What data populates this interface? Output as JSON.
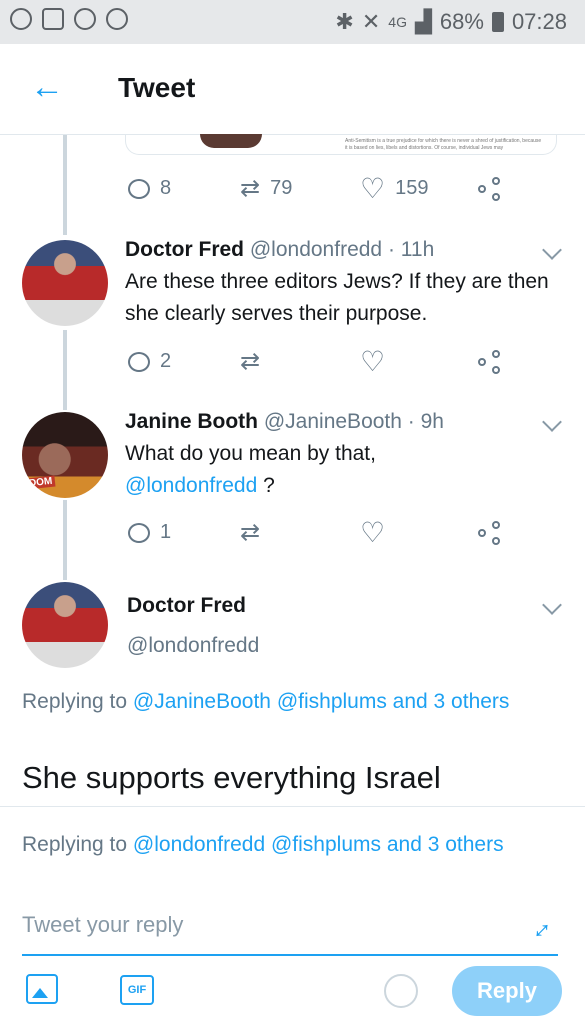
{
  "status_bar": {
    "network": "4G",
    "battery": "68%",
    "time": "07:28",
    "left_icons": [
      "whatsapp-icon",
      "gallery-icon",
      "whatsapp-icon",
      "wifi-shield-icon"
    ],
    "right_icons": [
      "bluetooth-icon",
      "mute-icon",
      "signal-icon",
      "battery-icon"
    ]
  },
  "header": {
    "title": "Tweet",
    "back_icon": "back-arrow-icon"
  },
  "top_tweet": {
    "actions": {
      "reply_count": "8",
      "retweet_count": "79",
      "like_count": "159"
    },
    "media_text": "Anti-Semitism is a true prejudice for which there is never a shred of justification, because it is based on lies, libels and distortions. Of course, individual Jews may"
  },
  "tweets": [
    {
      "name": "Doctor Fred",
      "handle": "@londonfredd",
      "time": "· 11h",
      "text": "Are these three editors Jews? If they are then she clearly serves their purpose.",
      "reply_count": "2"
    },
    {
      "name": "Janine Booth",
      "handle": "@JanineBooth",
      "time": "· 9h",
      "text": "What do you mean by that,",
      "mention": "@londonfredd",
      "after_mention": " ?",
      "reply_count": "1",
      "avatar_label": "DOM"
    }
  ],
  "main_tweet": {
    "name": "Doctor Fred",
    "handle": "@londonfredd",
    "replying_prefix": "Replying to",
    "replying_to": "@JanineBooth @fishplums and 3 others",
    "text": "She supports everything Israel"
  },
  "composer": {
    "replying_prefix": "Replying to",
    "replying_to": "@londonfredd @fishplums and 3 others",
    "placeholder": "Tweet your reply",
    "gif_label": "GIF",
    "reply_button": "Reply"
  },
  "colors": {
    "accent": "#1da1f2",
    "reply_button_disabled": "#8ed0f9",
    "muted": "#657786"
  }
}
